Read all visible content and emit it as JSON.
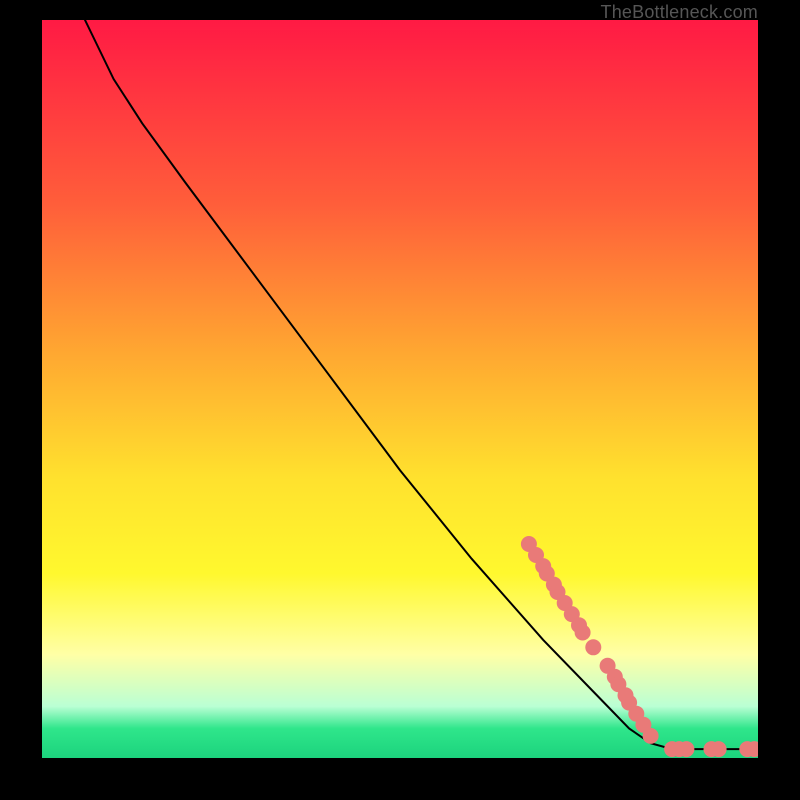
{
  "attribution": "TheBottleneck.com",
  "chart_data": {
    "type": "line",
    "title": "",
    "xlabel": "",
    "ylabel": "",
    "xlim": [
      0,
      100
    ],
    "ylim": [
      0,
      100
    ],
    "grid": false,
    "legend": false,
    "curve": [
      {
        "x": 6,
        "y": 100
      },
      {
        "x": 8,
        "y": 96
      },
      {
        "x": 10,
        "y": 92
      },
      {
        "x": 14,
        "y": 86
      },
      {
        "x": 20,
        "y": 78
      },
      {
        "x": 30,
        "y": 65
      },
      {
        "x": 40,
        "y": 52
      },
      {
        "x": 50,
        "y": 39
      },
      {
        "x": 60,
        "y": 27
      },
      {
        "x": 70,
        "y": 16
      },
      {
        "x": 78,
        "y": 8
      },
      {
        "x": 82,
        "y": 4
      },
      {
        "x": 85,
        "y": 2
      },
      {
        "x": 88,
        "y": 1.2
      },
      {
        "x": 92,
        "y": 1.2
      },
      {
        "x": 96,
        "y": 1.2
      },
      {
        "x": 100,
        "y": 1.2
      }
    ],
    "marker_points": [
      {
        "x": 68,
        "y": 29
      },
      {
        "x": 69,
        "y": 27.5
      },
      {
        "x": 70,
        "y": 26
      },
      {
        "x": 70.5,
        "y": 25
      },
      {
        "x": 71.5,
        "y": 23.5
      },
      {
        "x": 72,
        "y": 22.5
      },
      {
        "x": 73,
        "y": 21
      },
      {
        "x": 74,
        "y": 19.5
      },
      {
        "x": 75,
        "y": 18
      },
      {
        "x": 75.5,
        "y": 17
      },
      {
        "x": 77,
        "y": 15
      },
      {
        "x": 79,
        "y": 12.5
      },
      {
        "x": 80,
        "y": 11
      },
      {
        "x": 80.5,
        "y": 10
      },
      {
        "x": 81.5,
        "y": 8.5
      },
      {
        "x": 82,
        "y": 7.5
      },
      {
        "x": 83,
        "y": 6
      },
      {
        "x": 84,
        "y": 4.5
      },
      {
        "x": 85,
        "y": 3
      },
      {
        "x": 88,
        "y": 1.2
      },
      {
        "x": 89,
        "y": 1.2
      },
      {
        "x": 90,
        "y": 1.2
      },
      {
        "x": 93.5,
        "y": 1.2
      },
      {
        "x": 94.5,
        "y": 1.2
      },
      {
        "x": 98.5,
        "y": 1.2
      },
      {
        "x": 99.5,
        "y": 1.2
      }
    ],
    "marker_color": "#e97a78",
    "marker_radius": 8
  }
}
